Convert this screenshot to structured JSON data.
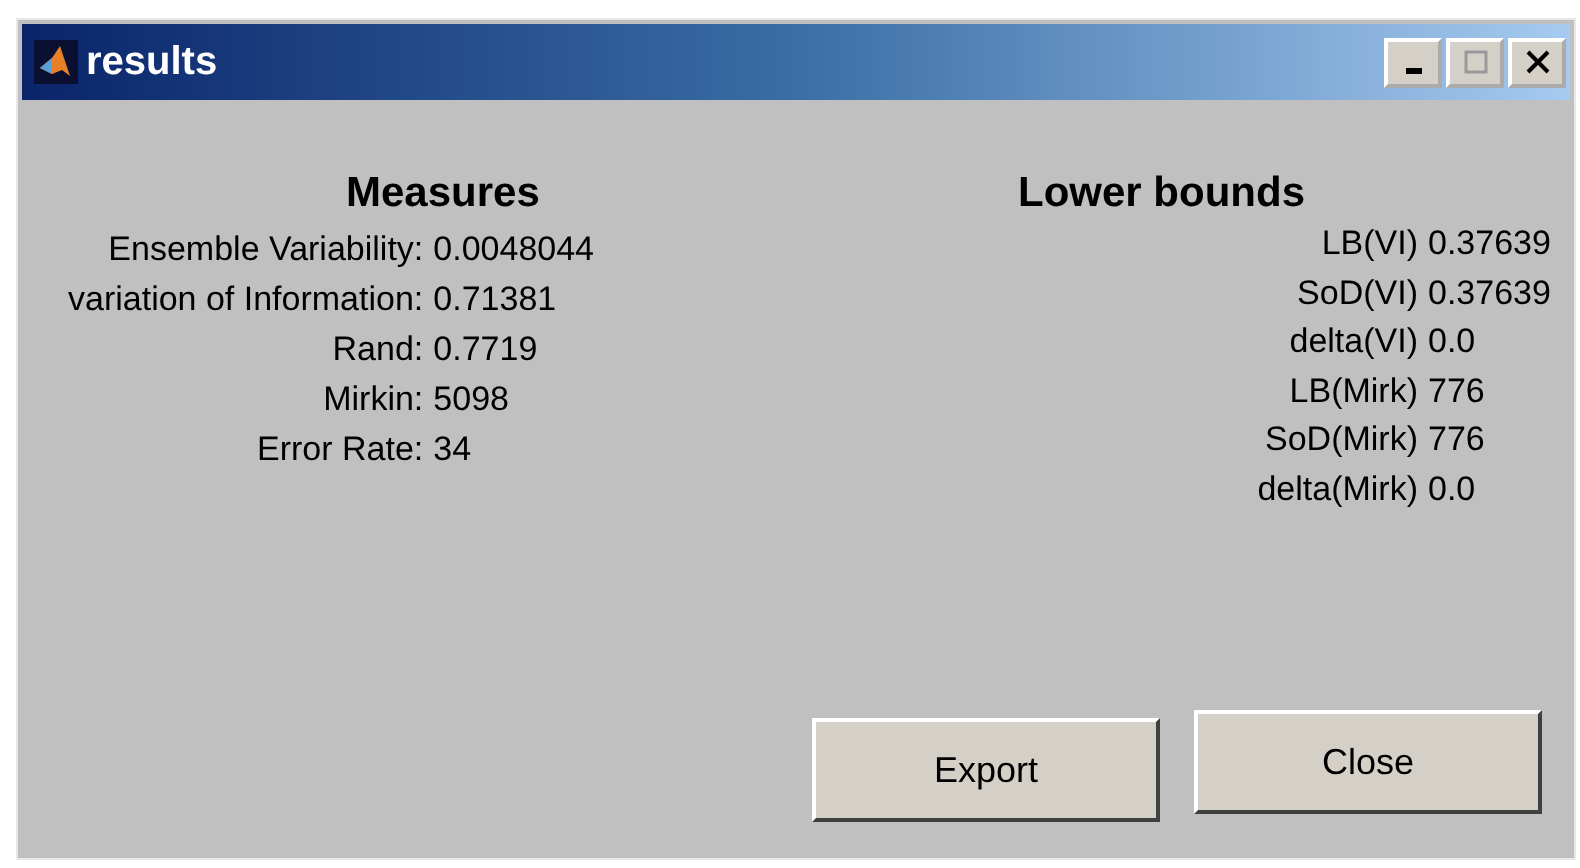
{
  "window": {
    "title": "results"
  },
  "measures": {
    "heading": "Measures",
    "rows": [
      {
        "label": "Ensemble Variability:",
        "value": "0.0048044"
      },
      {
        "label": "variation of Information:",
        "value": "0.71381"
      },
      {
        "label": "Rand:",
        "value": "0.7719"
      },
      {
        "label": "Mirkin:",
        "value": "5098"
      },
      {
        "label": "Error Rate:",
        "value": "34"
      }
    ]
  },
  "lower_bounds": {
    "heading": "Lower bounds",
    "rows": [
      {
        "label": "LB(VI)",
        "value": "0.37639"
      },
      {
        "label": "SoD(VI)",
        "value": "0.37639"
      },
      {
        "label": "delta(VI)",
        "value": "0.0"
      },
      {
        "label": "LB(Mirk)",
        "value": "776"
      },
      {
        "label": "SoD(Mirk)",
        "value": "776"
      },
      {
        "label": "delta(Mirk)",
        "value": "0.0"
      }
    ]
  },
  "buttons": [
    "Export",
    "Close"
  ]
}
